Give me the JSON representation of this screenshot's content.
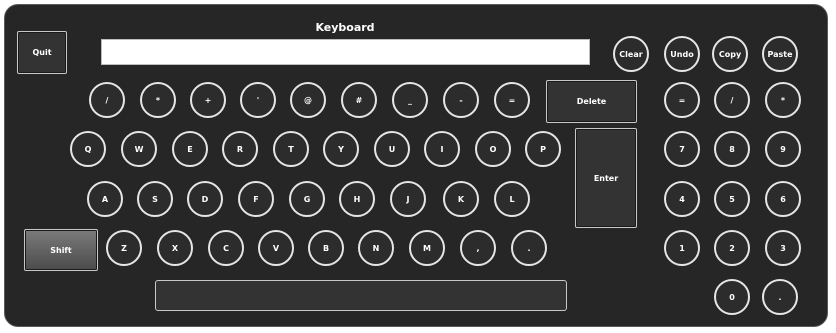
{
  "title": "Keyboard",
  "input_value": "",
  "buttons": {
    "quit": "Quit",
    "clear": "Clear",
    "undo": "Undo",
    "copy": "Copy",
    "paste": "Paste",
    "delete": "Delete",
    "enter": "Enter",
    "shift": "Shift"
  },
  "keys": {
    "row1": [
      "/",
      "*",
      "+",
      "'",
      "@",
      "#",
      "_",
      "-",
      "="
    ],
    "row2": [
      "Q",
      "W",
      "E",
      "R",
      "T",
      "Y",
      "U",
      "I",
      "O",
      "P"
    ],
    "row3": [
      "A",
      "S",
      "D",
      "F",
      "G",
      "H",
      "J",
      "K",
      "L"
    ],
    "row4": [
      "Z",
      "X",
      "C",
      "V",
      "B",
      "N",
      "M",
      ",",
      "."
    ],
    "numpad": [
      "=",
      "/",
      "*",
      "7",
      "8",
      "9",
      "4",
      "5",
      "6",
      "1",
      "2",
      "3",
      "0",
      "."
    ]
  }
}
